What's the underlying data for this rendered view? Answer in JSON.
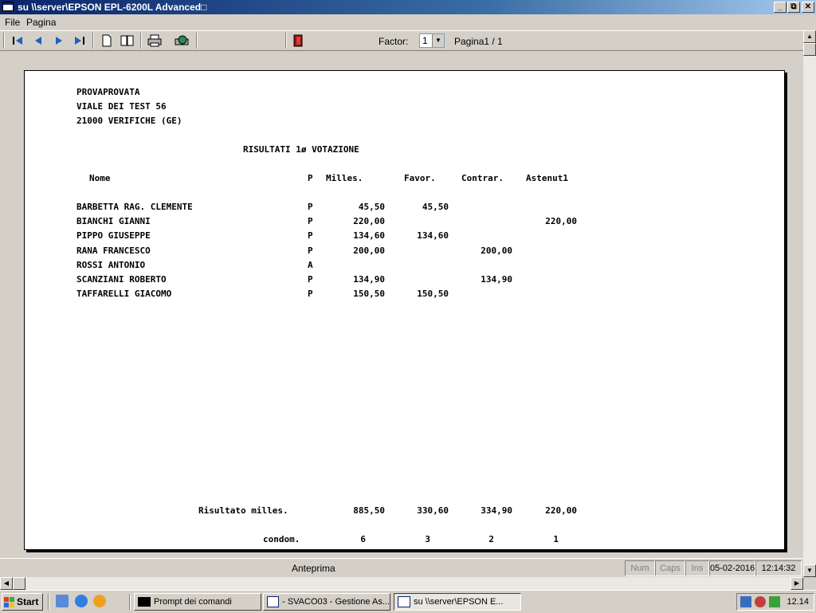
{
  "window": {
    "title": "su \\\\server\\EPSON EPL-6200L Advanced□"
  },
  "window_buttons": {
    "minimize": "_",
    "restore": "⧉",
    "close": "✕"
  },
  "menu": {
    "items": [
      "File",
      "Pagina"
    ]
  },
  "toolbar": {
    "buttons": [
      "first-page",
      "prev-page",
      "next-page",
      "last-page",
      "single-page",
      "two-pages",
      "print",
      "setup",
      "exit"
    ],
    "factor_label": "Factor:",
    "factor_value": "1",
    "page_indicator": "Pagina1 / 1"
  },
  "report": {
    "address": [
      "PROVAPROVATA",
      "VIALE DEI TEST 56",
      "21000 VERIFICHE (GE)"
    ],
    "title": "RISULTATI 1ø VOTAZIONE",
    "headers": {
      "name": "Nome",
      "presence": "P",
      "milles": "Milles.",
      "favor": "Favor.",
      "contrar": "Contrar.",
      "astenuti": "Astenut1"
    },
    "rows": [
      {
        "name": "BARBETTA RAG. CLEMENTE",
        "p": "P",
        "milles": "45,50",
        "favor": "45,50",
        "contrar": "",
        "astenuti": ""
      },
      {
        "name": "BIANCHI GIANNI",
        "p": "P",
        "milles": "220,00",
        "favor": "",
        "contrar": "",
        "astenuti": "220,00"
      },
      {
        "name": "PIPPO GIUSEPPE",
        "p": "P",
        "milles": "134,60",
        "favor": "134,60",
        "contrar": "",
        "astenuti": ""
      },
      {
        "name": "RANA FRANCESCO",
        "p": "P",
        "milles": "200,00",
        "favor": "",
        "contrar": "200,00",
        "astenuti": ""
      },
      {
        "name": "ROSSI ANTONIO",
        "p": "A",
        "milles": "",
        "favor": "",
        "contrar": "",
        "astenuti": ""
      },
      {
        "name": "SCANZIANI ROBERTO",
        "p": "P",
        "milles": "134,90",
        "favor": "",
        "contrar": "134,90",
        "astenuti": ""
      },
      {
        "name": "TAFFARELLI GIACOMO",
        "p": "P",
        "milles": "150,50",
        "favor": "150,50",
        "contrar": "",
        "astenuti": ""
      }
    ],
    "totals": {
      "label": "Risultato milles.",
      "milles": "885,50",
      "favor": "330,60",
      "contrar": "334,90",
      "astenuti": "220,00"
    },
    "counts": {
      "label": "condom.",
      "milles": "6",
      "favor": "3",
      "contrar": "2",
      "astenuti": "1"
    }
  },
  "statusbar": {
    "text": "Anteprima",
    "panels": [
      "Num",
      "Caps",
      "Ins",
      "05-02-2016",
      "12:14:32"
    ]
  },
  "taskbar": {
    "start": "Start",
    "tasks": [
      "Prompt dei comandi",
      "- SVACO03 - Gestione As...",
      "su \\\\server\\EPSON E..."
    ],
    "clock": "12.14"
  }
}
